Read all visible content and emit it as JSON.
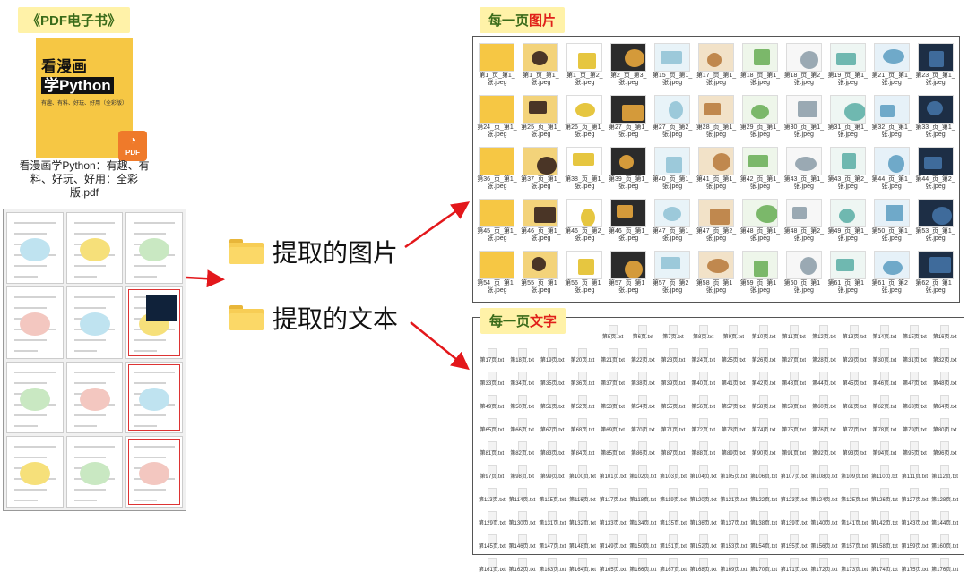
{
  "colors": {
    "tag_bg": "#fff2a8",
    "tag_text": "#3a6b1a",
    "accent_red": "#e0201a",
    "folder": "#f7cd55",
    "cover": "#f6c744"
  },
  "left": {
    "title": "《PDF电子书》",
    "book": {
      "title_line1": "看漫画",
      "title_line2": "学Python",
      "subtitle": "有趣、有料、好玩、好用（全彩版）",
      "badge": "PDF",
      "filename": "看漫画学Python：有趣、有料、好玩、好用：全彩版.pdf"
    },
    "page_count": 12
  },
  "folders": {
    "images": {
      "label": "提取的图片",
      "icon": "folder-icon"
    },
    "texts": {
      "label": "提取的文本",
      "icon": "folder-icon"
    }
  },
  "images_panel": {
    "title_prefix": "每一页",
    "title_highlight": "图片",
    "items": [
      "第1_页_第1_张.jpeg",
      "第1_页_第1_张.jpeg",
      "第1_页_第2_张.jpeg",
      "第2_页_第3_张.jpeg",
      "第15_页_第1_张.jpeg",
      "第17_页_第1_张.jpeg",
      "第18_页_第1_张.jpeg",
      "第18_页_第2_张.jpeg",
      "第19_页_第1_张.jpeg",
      "第21_页_第1_张.jpeg",
      "第23_页_第1_张.jpeg",
      "第24_页_第1_张.jpeg",
      "第25_页_第1_张.jpeg",
      "第26_页_第1_张.jpeg",
      "第27_页_第1_张.jpeg",
      "第27_页_第2_张.jpeg",
      "第28_页_第1_张.jpeg",
      "第29_页_第1_张.jpeg",
      "第30_页_第1_张.jpeg",
      "第31_页_第1_张.jpeg",
      "第32_页_第1_张.jpeg",
      "第33_页_第1_张.jpeg",
      "第36_页_第1_张.jpeg",
      "第37_页_第1_张.jpeg",
      "第38_页_第1_张.jpeg",
      "第39_页_第1_张.jpeg",
      "第40_页_第1_张.jpeg",
      "第41_页_第1_张.jpeg",
      "第42_页_第1_张.jpeg",
      "第43_页_第1_张.jpeg",
      "第43_页_第2_张.jpeg",
      "第44_页_第1_张.jpeg",
      "第44_页_第2_张.jpeg",
      "第45_页_第1_张.jpeg",
      "第46_页_第1_张.jpeg",
      "第46_页_第2_张.jpeg",
      "第46_页_第1_张.jpeg",
      "第47_页_第1_张.jpeg",
      "第47_页_第2_张.jpeg",
      "第48_页_第1_张.jpeg",
      "第48_页_第2_张.jpeg",
      "第49_页_第1_张.jpeg",
      "第50_页_第1_张.jpeg",
      "第53_页_第1_张.jpeg",
      "第54_页_第1_张.jpeg",
      "第55_页_第1_张.jpeg",
      "第56_页_第1_张.jpeg",
      "第57_页_第1_张.jpeg",
      "第57_页_第2_张.jpeg",
      "第58_页_第1_张.jpeg",
      "第59_页_第1_张.jpeg",
      "第60_页_第1_张.jpeg",
      "第61_页_第1_张.jpeg",
      "第61_页_第2_张.jpeg",
      "第62_页_第1_张.jpeg"
    ]
  },
  "texts_panel": {
    "title_prefix": "每一页",
    "title_highlight": "文字",
    "items": [
      "第5页.txt",
      "第6页.txt",
      "第7页.txt",
      "第8页.txt",
      "第9页.txt",
      "第10页.txt",
      "第11页.txt",
      "第12页.txt",
      "第13页.txt",
      "第14页.txt",
      "第15页.txt",
      "第16页.txt",
      "第17页.txt",
      "第18页.txt",
      "第19页.txt",
      "第20页.txt",
      "第21页.txt",
      "第22页.txt",
      "第23页.txt",
      "第24页.txt",
      "第25页.txt",
      "第26页.txt",
      "第27页.txt",
      "第28页.txt",
      "第29页.txt",
      "第30页.txt",
      "第31页.txt",
      "第32页.txt",
      "第33页.txt",
      "第34页.txt",
      "第35页.txt",
      "第36页.txt",
      "第37页.txt",
      "第38页.txt",
      "第39页.txt",
      "第40页.txt",
      "第41页.txt",
      "第42页.txt",
      "第43页.txt",
      "第44页.txt",
      "第45页.txt",
      "第46页.txt",
      "第47页.txt",
      "第48页.txt",
      "第49页.txt",
      "第50页.txt",
      "第51页.txt",
      "第52页.txt",
      "第53页.txt",
      "第54页.txt",
      "第55页.txt",
      "第56页.txt",
      "第57页.txt",
      "第58页.txt",
      "第59页.txt",
      "第60页.txt",
      "第61页.txt",
      "第62页.txt",
      "第63页.txt",
      "第64页.txt",
      "第65页.txt",
      "第66页.txt",
      "第67页.txt",
      "第68页.txt",
      "第69页.txt",
      "第70页.txt",
      "第71页.txt",
      "第72页.txt",
      "第73页.txt",
      "第74页.txt",
      "第75页.txt",
      "第76页.txt",
      "第77页.txt",
      "第78页.txt",
      "第79页.txt",
      "第80页.txt",
      "第81页.txt",
      "第82页.txt",
      "第83页.txt",
      "第84页.txt",
      "第85页.txt",
      "第86页.txt",
      "第87页.txt",
      "第88页.txt",
      "第89页.txt",
      "第90页.txt",
      "第91页.txt",
      "第92页.txt",
      "第93页.txt",
      "第94页.txt",
      "第95页.txt",
      "第96页.txt",
      "第97页.txt",
      "第98页.txt",
      "第99页.txt",
      "第100页.txt",
      "第101页.txt",
      "第102页.txt",
      "第103页.txt",
      "第104页.txt",
      "第105页.txt",
      "第106页.txt",
      "第107页.txt",
      "第108页.txt",
      "第109页.txt",
      "第110页.txt",
      "第111页.txt",
      "第112页.txt",
      "第113页.txt",
      "第114页.txt",
      "第115页.txt",
      "第116页.txt",
      "第117页.txt",
      "第118页.txt",
      "第119页.txt",
      "第120页.txt",
      "第121页.txt",
      "第122页.txt",
      "第123页.txt",
      "第124页.txt",
      "第125页.txt",
      "第126页.txt",
      "第127页.txt",
      "第128页.txt",
      "第129页.txt",
      "第130页.txt",
      "第131页.txt",
      "第132页.txt",
      "第133页.txt",
      "第134页.txt",
      "第135页.txt",
      "第136页.txt",
      "第137页.txt",
      "第138页.txt",
      "第139页.txt",
      "第140页.txt",
      "第141页.txt",
      "第142页.txt",
      "第143页.txt",
      "第144页.txt",
      "第145页.txt",
      "第146页.txt",
      "第147页.txt",
      "第148页.txt",
      "第149页.txt",
      "第150页.txt",
      "第151页.txt",
      "第152页.txt",
      "第153页.txt",
      "第154页.txt",
      "第155页.txt",
      "第156页.txt",
      "第157页.txt",
      "第158页.txt",
      "第159页.txt",
      "第160页.txt",
      "第161页.txt",
      "第162页.txt",
      "第163页.txt",
      "第164页.txt",
      "第165页.txt",
      "第166页.txt",
      "第167页.txt",
      "第168页.txt",
      "第169页.txt",
      "第170页.txt",
      "第171页.txt",
      "第172页.txt",
      "第173页.txt",
      "第174页.txt",
      "第175页.txt",
      "第176页.txt"
    ]
  }
}
